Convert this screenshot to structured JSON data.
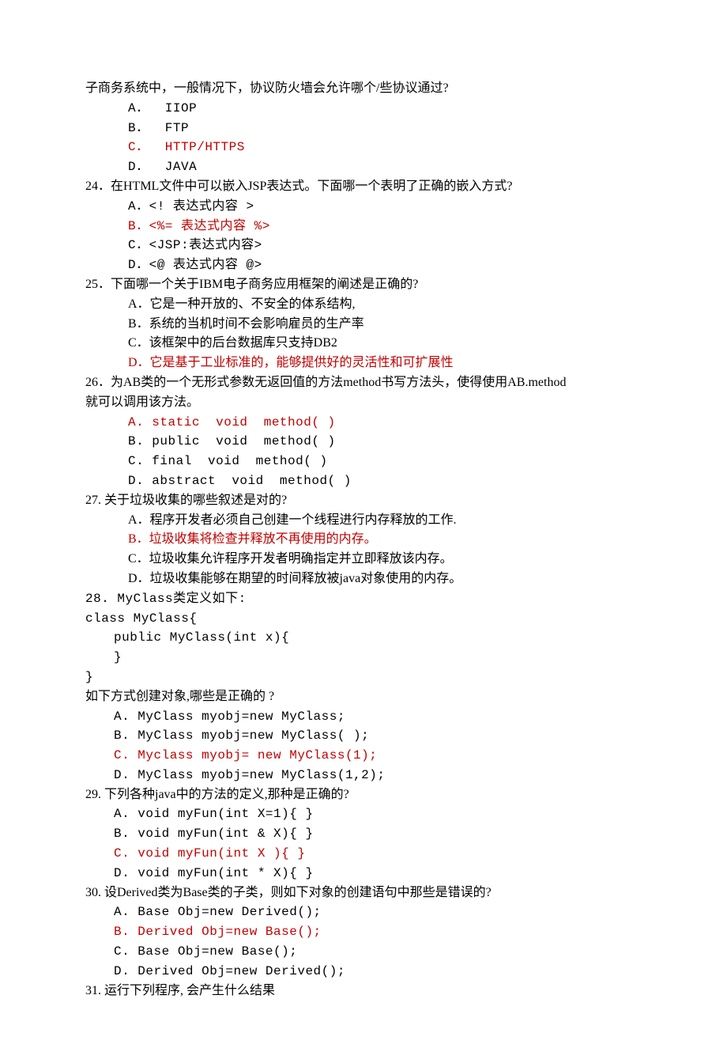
{
  "q23": {
    "stem": "子商务系统中，一般情况下，协议防火墙会允许哪个/些协议通过?",
    "opts": [
      {
        "t": "A．  IIOP",
        "red": false
      },
      {
        "t": "B．  FTP",
        "red": false
      },
      {
        "t": "C．  HTTP/HTTPS",
        "red": true
      },
      {
        "t": "D．  JAVA",
        "red": false
      }
    ]
  },
  "q24": {
    "stem": "24．在HTML文件中可以嵌入JSP表达式。下面哪一个表明了正确的嵌入方式?",
    "opts": [
      {
        "t": "A．<! 表达式内容 >",
        "red": false
      },
      {
        "t": "B．<%= 表达式内容 %>",
        "red": true
      },
      {
        "t": "C．<JSP:表达式内容>",
        "red": false
      },
      {
        "t": "D．<@ 表达式内容 @>",
        "red": false
      }
    ]
  },
  "q25": {
    "stem": "25．下面哪一个关于IBM电子商务应用框架的阐述是正确的?",
    "opts": [
      {
        "t": "A．它是一种开放的、不安全的体系结构,",
        "red": false
      },
      {
        "t": "B．系统的当机时间不会影响雇员的生产率",
        "red": false
      },
      {
        "t": "C．该框架中的后台数据库只支持DB2",
        "red": false
      },
      {
        "t": "D．它是基于工业标准的，能够提供好的灵活性和可扩展性",
        "red": true
      }
    ]
  },
  "q26": {
    "stem1": "26．为AB类的一个无形式参数无返回值的方法method书写方法头，使得使用AB.method",
    "stem2": "就可以调用该方法。",
    "opts": [
      {
        "t": "A. static  void  method( )",
        "red": true
      },
      {
        "t": "B. public  void  method( )",
        "red": false
      },
      {
        "t": "C. final  void  method( )",
        "red": false
      },
      {
        "t": "D. abstract  void  method( )",
        "red": false
      }
    ]
  },
  "q27": {
    "stem": "27. 关于垃圾收集的哪些叙述是对的?",
    "opts": [
      {
        "t": "A．程序开发者必须自己创建一个线程进行内存释放的工作.",
        "red": false
      },
      {
        "t": "B．垃圾收集将检查并释放不再使用的内存。",
        "red": true
      },
      {
        "t": "C．垃圾收集允许程序开发者明确指定并立即释放该内存。",
        "red": false
      },
      {
        "t": "D．垃圾收集能够在期望的时间释放被java对象使用的内存。",
        "red": false
      }
    ]
  },
  "q28": {
    "stem": "28. MyClass类定义如下:",
    "code1": "class MyClass{",
    "code2": "public MyClass(int x){",
    "code3": "}",
    "code4": "}",
    "stem2": "如下方式创建对象,哪些是正确的 ?",
    "opts": [
      {
        "t": "A. MyClass myobj=new MyClass;",
        "red": false
      },
      {
        "t": "B. MyClass myobj=new MyClass( );",
        "red": false
      },
      {
        "t": "C. Myclass myobj= new MyClass(1);",
        "red": true
      },
      {
        "t": "D. MyClass myobj=new MyClass(1,2);",
        "red": false
      }
    ]
  },
  "q29": {
    "stem": "29. 下列各种java中的方法的定义,那种是正确的?",
    "opts": [
      {
        "t": "A. void myFun(int X=1){ }",
        "red": false
      },
      {
        "t": "B. void myFun(int & X){ }",
        "red": false
      },
      {
        "t": "C. void myFun(int X ){ }",
        "red": true
      },
      {
        "t": "D. void myFun(int * X){ }",
        "red": false
      }
    ]
  },
  "q30": {
    "stem": "30. 设Derived类为Base类的子类，则如下对象的创建语句中那些是错误的?",
    "opts": [
      {
        "t": "A. Base Obj=new Derived();",
        "red": false
      },
      {
        "t": "B. Derived Obj=new Base();",
        "red": true
      },
      {
        "t": "C. Base Obj=new Base();",
        "red": false
      },
      {
        "t": "D. Derived Obj=new Derived();",
        "red": false
      }
    ]
  },
  "q31": {
    "stem": "31. 运行下列程序, 会产生什么结果"
  }
}
